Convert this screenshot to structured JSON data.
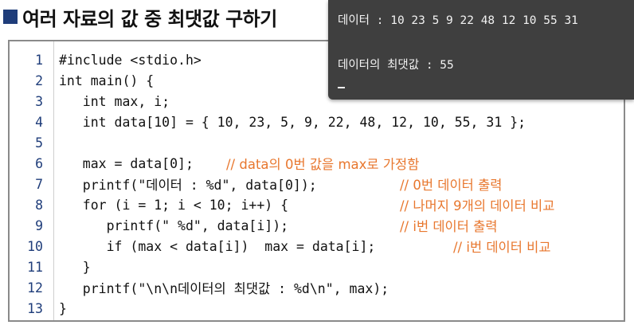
{
  "title": "여러 자료의 값 중 최댓값 구하기",
  "code_lines": [
    {
      "num": "1",
      "code": "#include <stdio.h>"
    },
    {
      "num": "2",
      "code": "int main() {"
    },
    {
      "num": "3",
      "code": "   int max, i;"
    },
    {
      "num": "4",
      "code": "   int data[10] = { 10, 23, 5, 9, 22, 48, 12, 10, 55, 31 };"
    },
    {
      "num": "5",
      "code": ""
    },
    {
      "num": "6",
      "code": "   max = data[0];"
    },
    {
      "num": "7",
      "code": "   printf(\"데이터 : %d\", data[0]);"
    },
    {
      "num": "8",
      "code": "   for (i = 1; i < 10; i++) {"
    },
    {
      "num": "9",
      "code": "      printf(\" %d\", data[i]);"
    },
    {
      "num": "10",
      "code": "      if (max < data[i])  max = data[i];"
    },
    {
      "num": "11",
      "code": "   }"
    },
    {
      "num": "12",
      "code": "   printf(\"\\n\\n데이터의 최댓값 : %d\\n\", max);"
    },
    {
      "num": "13",
      "code": "}"
    }
  ],
  "comments": [
    "// data의 0번 값을 max로 가정함",
    "// 0번 데이터 출력",
    "// 나머지 9개의 데이터 비교",
    "// i번 데이터 출력",
    "// i번 데이터 비교"
  ],
  "console": {
    "line1": "데이터 : 10 23 5 9 22 48 12 10 55 31",
    "line2": "데이터의 최댓값 : 55"
  }
}
